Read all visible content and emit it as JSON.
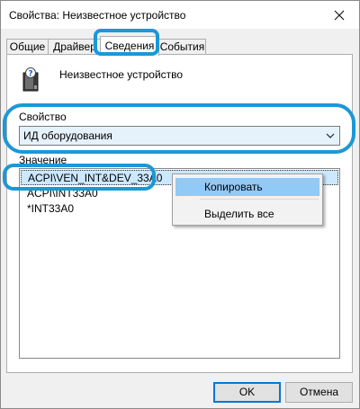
{
  "window": {
    "title": "Свойства: Неизвестное устройство"
  },
  "tabs": [
    {
      "label": "Общие"
    },
    {
      "label": "Драйвер"
    },
    {
      "label": "Сведения",
      "active": true
    },
    {
      "label": "События"
    }
  ],
  "device": {
    "name": "Неизвестное устройство",
    "icon": "unknown-device-icon"
  },
  "property": {
    "label": "Свойство",
    "selected_value": "ИД оборудования"
  },
  "values": {
    "label": "Значение",
    "items": [
      "ACPI\\VEN_INT&DEV_33A0",
      "ACPI\\INT33A0",
      "*INT33A0"
    ],
    "selected_index": 0
  },
  "context_menu": {
    "items": [
      {
        "label": "Копировать"
      },
      {
        "label": "Выделить все"
      }
    ]
  },
  "buttons": {
    "ok": "OK",
    "cancel": "Отмена"
  },
  "colors": {
    "annotation": "#1b98d6",
    "selection": "#cce8ff",
    "menu_hover": "#91c9f7"
  }
}
